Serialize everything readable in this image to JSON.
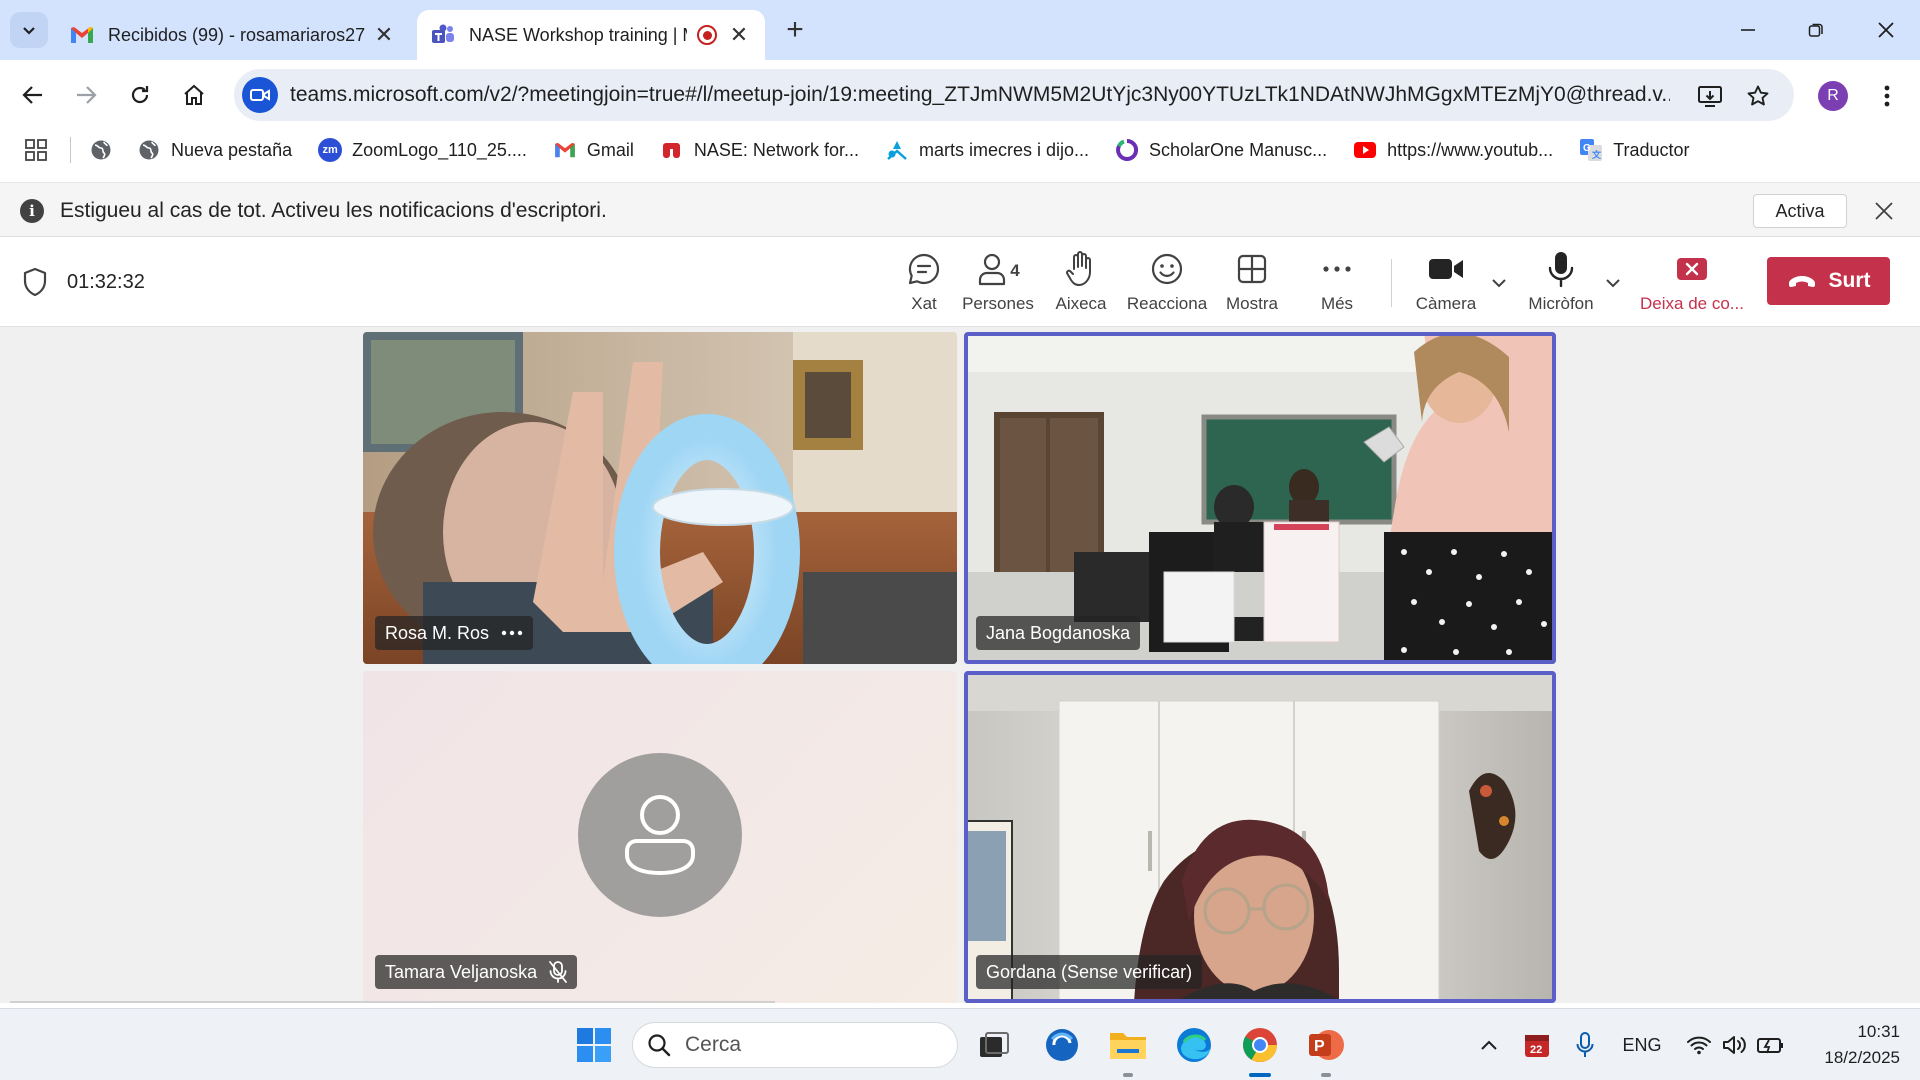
{
  "browser": {
    "tabs": [
      {
        "title": "Recibidos (99) - rosamariaros27",
        "favicon": "gmail-icon",
        "active": false
      },
      {
        "title": "NASE Workshop training | M",
        "favicon": "teams-icon",
        "active": true,
        "recording": true
      }
    ],
    "url": "teams.microsoft.com/v2/?meetingjoin=true#/l/meetup-join/19:meeting_ZTJmNWM5M2UtYjc3Ny00YTUzLTk1NDAtNWJhMGgxMTEzMjY0@thread.v...",
    "profile_initial": "R",
    "bookmarks": [
      {
        "label": "",
        "icon": "globe-icon"
      },
      {
        "label": "Nueva pestaña",
        "icon": "globe-icon"
      },
      {
        "label": "ZoomLogo_110_25....",
        "icon": "zoom-icon"
      },
      {
        "label": "Gmail",
        "icon": "gmail-icon"
      },
      {
        "label": "NASE: Network for...",
        "icon": "nase-icon"
      },
      {
        "label": "marts imecres i dijo...",
        "icon": "caixabank-icon"
      },
      {
        "label": "ScholarOne Manusc...",
        "icon": "scholarone-icon"
      },
      {
        "label": "https://www.youtub...",
        "icon": "youtube-icon"
      },
      {
        "label": "Traductor",
        "icon": "translate-icon"
      }
    ]
  },
  "notification": {
    "message": "Estigueu al cas de tot. Activeu les notificacions d'escriptori.",
    "action_label": "Activa"
  },
  "meeting": {
    "timer": "01:32:32",
    "controls": {
      "chat": "Xat",
      "people": "Persones",
      "people_count": "4",
      "raise": "Aixeca",
      "react": "Reacciona",
      "view": "Mostra",
      "more": "Més",
      "camera": "Càmera",
      "mic": "Micròfon",
      "stop_sharing": "Deixa de co...",
      "leave": "Surt"
    },
    "participants": [
      {
        "name": "Rosa M. Ros",
        "has_more": true,
        "speaking": false
      },
      {
        "name": "Jana Bogdanoska",
        "speaking": true
      },
      {
        "name": "Tamara Veljanoska",
        "muted": true,
        "speaking": false
      },
      {
        "name": "Gordana (Sense verificar)",
        "speaking": true
      }
    ],
    "accent_color": "#5b5fc7",
    "leave_color": "#c4314b"
  },
  "taskbar": {
    "search_placeholder": "Cerca",
    "language": "ENG",
    "time": "10:31",
    "date": "18/2/2025",
    "calendar_badge": "22"
  }
}
